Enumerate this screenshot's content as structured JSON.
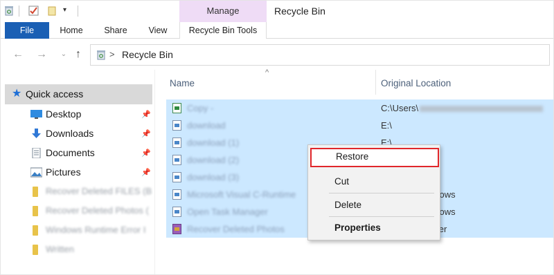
{
  "titlebar": {
    "qat_icons": [
      "recycle-bin-icon",
      "properties-check-icon",
      "new-folder-icon",
      "customize-dropdown-icon"
    ],
    "context_tab": "Manage",
    "window_title": "Recycle Bin"
  },
  "ribbon": {
    "tabs": [
      "File",
      "Home",
      "Share",
      "View"
    ],
    "tools_tab": "Recycle Bin Tools",
    "file_color": "#1a5fb4",
    "manage_color": "#efdcf6"
  },
  "address": {
    "path_separator": ">",
    "path": "Recycle Bin",
    "nav_icons": [
      "back-arrow-icon",
      "forward-arrow-icon",
      "recent-dropdown-icon",
      "up-arrow-icon"
    ]
  },
  "navpane": {
    "quick_access": "Quick access",
    "items": [
      {
        "label": "Desktop",
        "icon": "desktop-icon",
        "pinned": true
      },
      {
        "label": "Downloads",
        "icon": "download-arrow-icon",
        "pinned": true
      },
      {
        "label": "Documents",
        "icon": "documents-icon",
        "pinned": true
      },
      {
        "label": "Pictures",
        "icon": "pictures-icon",
        "pinned": true
      },
      {
        "label": "Recover Deleted FILES (B",
        "icon": "folder-icon",
        "pinned": false
      },
      {
        "label": "Recover Deleted Photos (",
        "icon": "folder-icon",
        "pinned": false
      },
      {
        "label": "Windows Runtime Error I",
        "icon": "folder-icon",
        "pinned": false
      },
      {
        "label": "Written",
        "icon": "folder-icon",
        "pinned": false
      }
    ]
  },
  "columns": {
    "name": "Name",
    "location": "Original Location",
    "sort_indicator": "^"
  },
  "files": [
    {
      "name": "Copy -",
      "icon": "excel-file-icon",
      "location": "C:\\Users\\"
    },
    {
      "name": "download",
      "icon": "image-file-icon",
      "location": "E:\\"
    },
    {
      "name": "download (1)",
      "icon": "image-file-icon",
      "location": "E:\\"
    },
    {
      "name": "download (2)",
      "icon": "image-file-icon",
      "location": ""
    },
    {
      "name": "download (3)",
      "icon": "image-file-icon",
      "location": ""
    },
    {
      "name": "Microsoft Visual C-Runtime",
      "icon": "image-file-icon",
      "location": "ndows"
    },
    {
      "name": "Open Task Manager",
      "icon": "image-file-icon",
      "location": "ndows"
    },
    {
      "name": "Recover Deleted Photos",
      "icon": "archive-file-icon",
      "location": "over"
    }
  ],
  "selection_color": "#cce8ff",
  "context_menu": {
    "restore": "Restore",
    "cut": "Cut",
    "delete": "Delete",
    "properties": "Properties",
    "highlight_color": "#e0262a"
  }
}
